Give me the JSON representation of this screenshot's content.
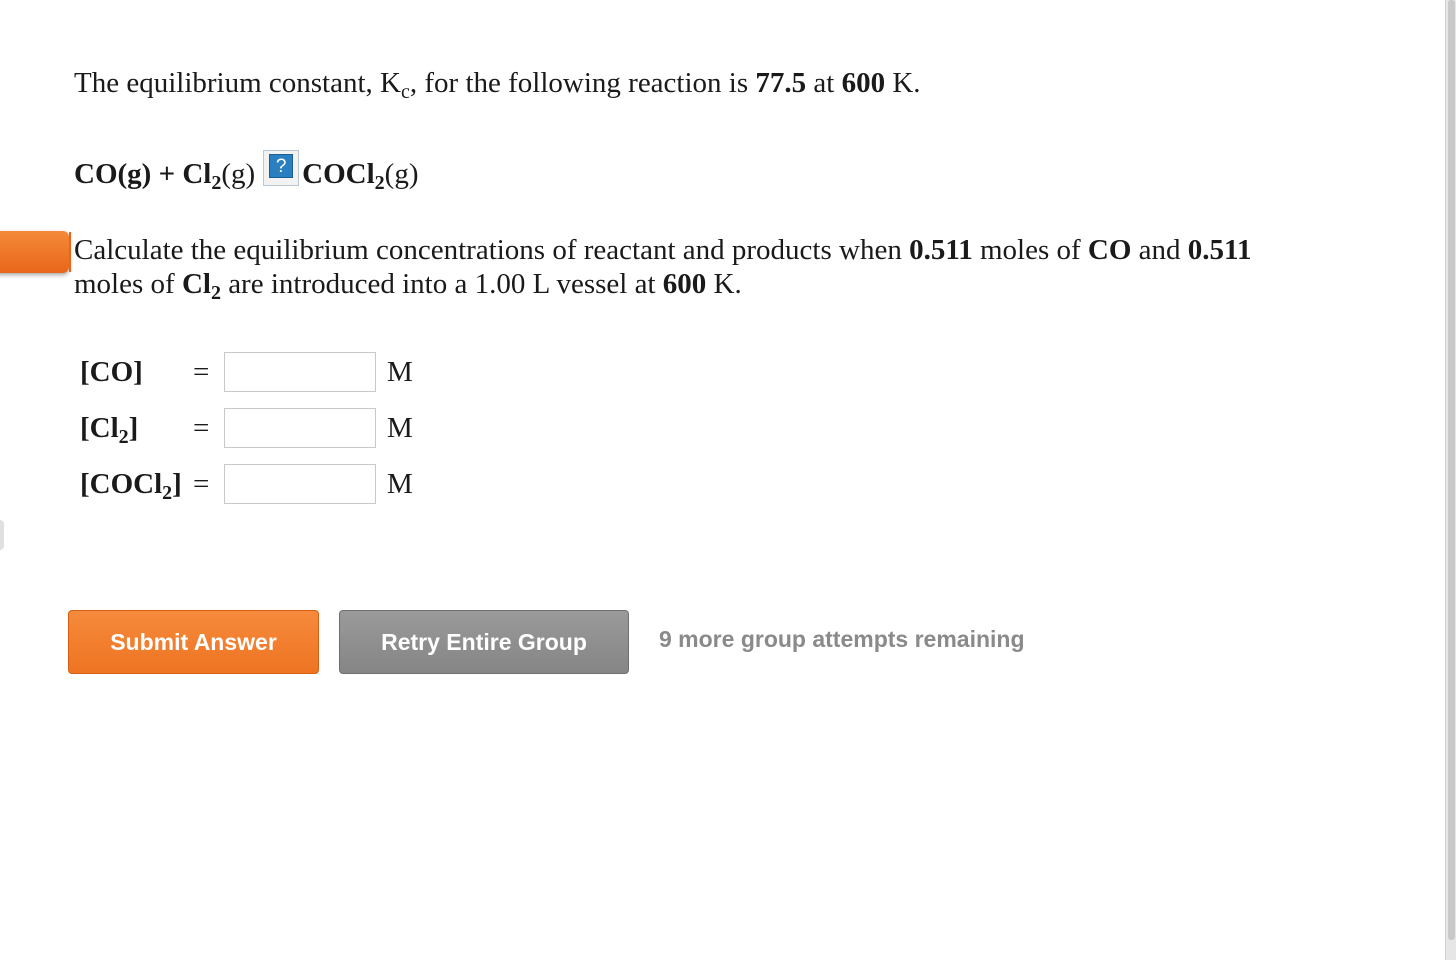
{
  "intro": {
    "t1": "The equilibrium constant, K",
    "sub_c": "c",
    "t2": ", for the following reaction is ",
    "k_value": "77.5",
    "t3": " at ",
    "temp": "600",
    "t4": " K."
  },
  "reaction": {
    "co": "CO(g) + Cl",
    "sub2a": "2",
    "g1": "(g)",
    "equilibrium_symbol": "?",
    "cocl": "COCl",
    "sub2b": "2",
    "g2": "(g)"
  },
  "question": {
    "t1": "Calculate the equilibrium concentrations of reactant and products when ",
    "moles_co": "0.511",
    "t2": " moles of ",
    "co": "CO",
    "t3": " and ",
    "moles_cl2": "0.511",
    "t4": "moles of ",
    "cl": "Cl",
    "sub2": "2",
    "t5": " are introduced into a 1.00 L vessel at ",
    "temp": "600",
    "t6": " K."
  },
  "answers": [
    {
      "label": "[CO]",
      "label_sub": "",
      "label_end": "",
      "equals": "=",
      "value": "",
      "unit": "M"
    },
    {
      "label": "[Cl",
      "label_sub": "2",
      "label_end": "]",
      "equals": "=",
      "value": "",
      "unit": "M"
    },
    {
      "label": "[COCl",
      "label_sub": "2",
      "label_end": "]",
      "equals": "=",
      "value": "",
      "unit": "M"
    }
  ],
  "buttons": {
    "submit": "Submit Answer",
    "retry": "Retry Entire Group"
  },
  "attempts": "9 more group attempts remaining",
  "colors": {
    "accent_orange": "#ee7422",
    "button_gray": "#8c8c8c",
    "help_blue": "#2a7fc0"
  }
}
